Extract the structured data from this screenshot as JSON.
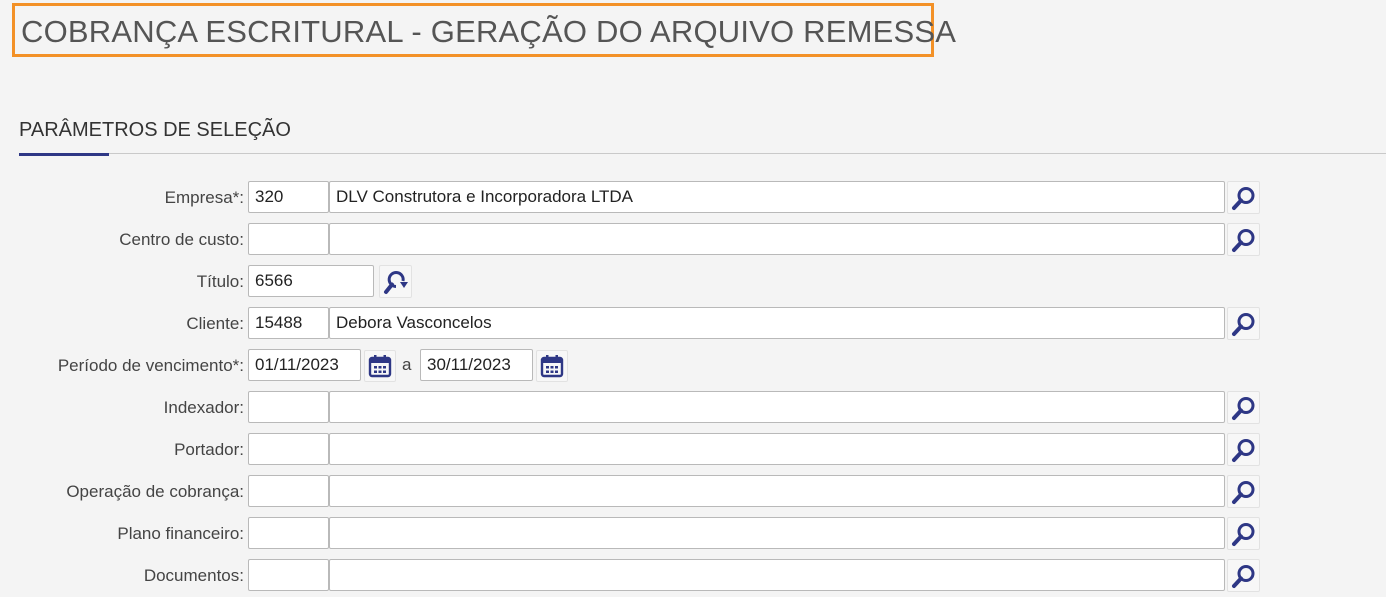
{
  "header": {
    "title": "COBRANÇA ESCRITURAL - GERAÇÃO DO ARQUIVO REMESSA"
  },
  "section": {
    "title": "PARÂMETROS DE SELEÇÃO"
  },
  "colors": {
    "accent": "#f39127",
    "brand": "#2e3785",
    "icon": "#2e3785"
  },
  "form": {
    "empresa": {
      "label": "Empresa*:",
      "code": "320",
      "desc": "DLV Construtora e Incorporadora LTDA",
      "icon": "search-icon"
    },
    "centro_custo": {
      "label": "Centro de custo:",
      "code": "",
      "desc": "",
      "icon": "search-icon"
    },
    "titulo": {
      "label": "Título:",
      "value": "6566",
      "icon": "search-refresh-icon"
    },
    "cliente": {
      "label": "Cliente:",
      "code": "15488",
      "desc": "Debora Vasconcelos",
      "icon": "search-icon"
    },
    "periodo": {
      "label": "Período de vencimento*:",
      "start": "01/11/2023",
      "separator": "a",
      "end": "30/11/2023",
      "icon": "calendar-icon"
    },
    "indexador": {
      "label": "Indexador:",
      "code": "",
      "desc": "",
      "icon": "search-icon"
    },
    "portador": {
      "label": "Portador:",
      "code": "",
      "desc": "",
      "icon": "search-icon"
    },
    "operacao": {
      "label": "Operação de cobrança:",
      "code": "",
      "desc": "",
      "icon": "search-icon"
    },
    "plano": {
      "label": "Plano financeiro:",
      "code": "",
      "desc": "",
      "icon": "search-icon"
    },
    "documentos": {
      "label": "Documentos:",
      "code": "",
      "desc": "",
      "icon": "search-icon"
    }
  }
}
